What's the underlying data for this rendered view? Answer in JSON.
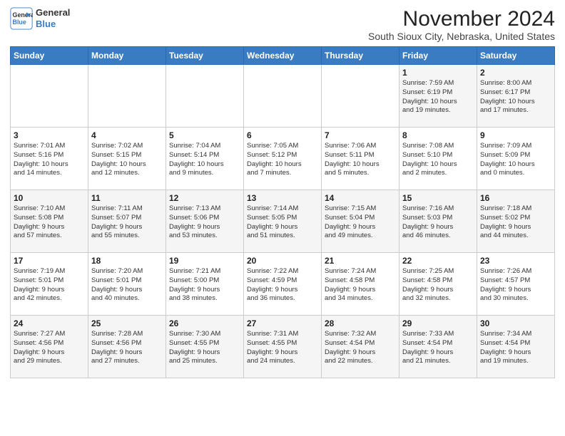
{
  "header": {
    "logo_line1": "General",
    "logo_line2": "Blue",
    "title": "November 2024",
    "subtitle": "South Sioux City, Nebraska, United States"
  },
  "calendar": {
    "days_of_week": [
      "Sunday",
      "Monday",
      "Tuesday",
      "Wednesday",
      "Thursday",
      "Friday",
      "Saturday"
    ],
    "weeks": [
      [
        {
          "day": "",
          "info": ""
        },
        {
          "day": "",
          "info": ""
        },
        {
          "day": "",
          "info": ""
        },
        {
          "day": "",
          "info": ""
        },
        {
          "day": "",
          "info": ""
        },
        {
          "day": "1",
          "info": "Sunrise: 7:59 AM\nSunset: 6:19 PM\nDaylight: 10 hours\nand 19 minutes."
        },
        {
          "day": "2",
          "info": "Sunrise: 8:00 AM\nSunset: 6:17 PM\nDaylight: 10 hours\nand 17 minutes."
        }
      ],
      [
        {
          "day": "3",
          "info": "Sunrise: 7:01 AM\nSunset: 5:16 PM\nDaylight: 10 hours\nand 14 minutes."
        },
        {
          "day": "4",
          "info": "Sunrise: 7:02 AM\nSunset: 5:15 PM\nDaylight: 10 hours\nand 12 minutes."
        },
        {
          "day": "5",
          "info": "Sunrise: 7:04 AM\nSunset: 5:14 PM\nDaylight: 10 hours\nand 9 minutes."
        },
        {
          "day": "6",
          "info": "Sunrise: 7:05 AM\nSunset: 5:12 PM\nDaylight: 10 hours\nand 7 minutes."
        },
        {
          "day": "7",
          "info": "Sunrise: 7:06 AM\nSunset: 5:11 PM\nDaylight: 10 hours\nand 5 minutes."
        },
        {
          "day": "8",
          "info": "Sunrise: 7:08 AM\nSunset: 5:10 PM\nDaylight: 10 hours\nand 2 minutes."
        },
        {
          "day": "9",
          "info": "Sunrise: 7:09 AM\nSunset: 5:09 PM\nDaylight: 10 hours\nand 0 minutes."
        }
      ],
      [
        {
          "day": "10",
          "info": "Sunrise: 7:10 AM\nSunset: 5:08 PM\nDaylight: 9 hours\nand 57 minutes."
        },
        {
          "day": "11",
          "info": "Sunrise: 7:11 AM\nSunset: 5:07 PM\nDaylight: 9 hours\nand 55 minutes."
        },
        {
          "day": "12",
          "info": "Sunrise: 7:13 AM\nSunset: 5:06 PM\nDaylight: 9 hours\nand 53 minutes."
        },
        {
          "day": "13",
          "info": "Sunrise: 7:14 AM\nSunset: 5:05 PM\nDaylight: 9 hours\nand 51 minutes."
        },
        {
          "day": "14",
          "info": "Sunrise: 7:15 AM\nSunset: 5:04 PM\nDaylight: 9 hours\nand 49 minutes."
        },
        {
          "day": "15",
          "info": "Sunrise: 7:16 AM\nSunset: 5:03 PM\nDaylight: 9 hours\nand 46 minutes."
        },
        {
          "day": "16",
          "info": "Sunrise: 7:18 AM\nSunset: 5:02 PM\nDaylight: 9 hours\nand 44 minutes."
        }
      ],
      [
        {
          "day": "17",
          "info": "Sunrise: 7:19 AM\nSunset: 5:01 PM\nDaylight: 9 hours\nand 42 minutes."
        },
        {
          "day": "18",
          "info": "Sunrise: 7:20 AM\nSunset: 5:01 PM\nDaylight: 9 hours\nand 40 minutes."
        },
        {
          "day": "19",
          "info": "Sunrise: 7:21 AM\nSunset: 5:00 PM\nDaylight: 9 hours\nand 38 minutes."
        },
        {
          "day": "20",
          "info": "Sunrise: 7:22 AM\nSunset: 4:59 PM\nDaylight: 9 hours\nand 36 minutes."
        },
        {
          "day": "21",
          "info": "Sunrise: 7:24 AM\nSunset: 4:58 PM\nDaylight: 9 hours\nand 34 minutes."
        },
        {
          "day": "22",
          "info": "Sunrise: 7:25 AM\nSunset: 4:58 PM\nDaylight: 9 hours\nand 32 minutes."
        },
        {
          "day": "23",
          "info": "Sunrise: 7:26 AM\nSunset: 4:57 PM\nDaylight: 9 hours\nand 30 minutes."
        }
      ],
      [
        {
          "day": "24",
          "info": "Sunrise: 7:27 AM\nSunset: 4:56 PM\nDaylight: 9 hours\nand 29 minutes."
        },
        {
          "day": "25",
          "info": "Sunrise: 7:28 AM\nSunset: 4:56 PM\nDaylight: 9 hours\nand 27 minutes."
        },
        {
          "day": "26",
          "info": "Sunrise: 7:30 AM\nSunset: 4:55 PM\nDaylight: 9 hours\nand 25 minutes."
        },
        {
          "day": "27",
          "info": "Sunrise: 7:31 AM\nSunset: 4:55 PM\nDaylight: 9 hours\nand 24 minutes."
        },
        {
          "day": "28",
          "info": "Sunrise: 7:32 AM\nSunset: 4:54 PM\nDaylight: 9 hours\nand 22 minutes."
        },
        {
          "day": "29",
          "info": "Sunrise: 7:33 AM\nSunset: 4:54 PM\nDaylight: 9 hours\nand 21 minutes."
        },
        {
          "day": "30",
          "info": "Sunrise: 7:34 AM\nSunset: 4:54 PM\nDaylight: 9 hours\nand 19 minutes."
        }
      ]
    ]
  }
}
